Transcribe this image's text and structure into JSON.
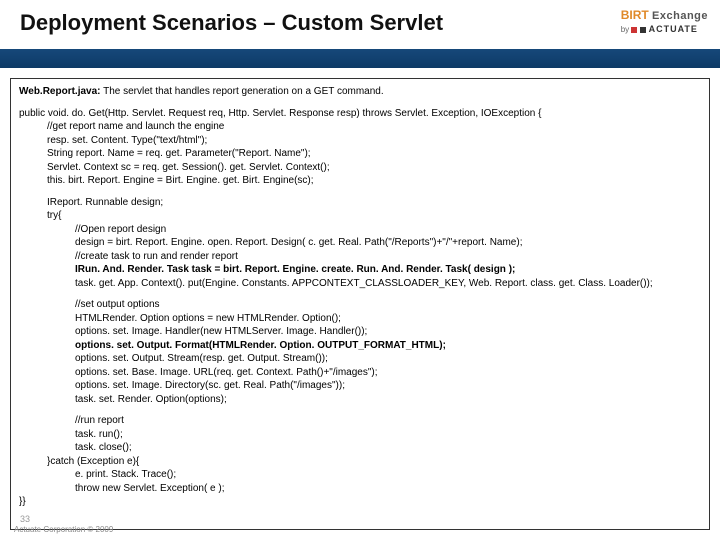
{
  "title": "Deployment Scenarios – Custom Servlet",
  "brand": {
    "birt": "BIRT",
    "exchange": "Exchange",
    "by": "by",
    "actuate": "ACTUATE"
  },
  "desc": {
    "filename": "Web.Report.java:",
    "text": " The servlet that handles report generation on a GET command."
  },
  "code": {
    "l0": "public void. do. Get(Http. Servlet. Request req, Http. Servlet. Response resp) throws Servlet. Exception, IOException {",
    "l1": "//get report name and launch the engine",
    "l2": "resp. set. Content. Type(\"text/html\");",
    "l3": "String report. Name = req. get. Parameter(\"Report. Name\");",
    "l4": "Servlet. Context sc = req. get. Session(). get. Servlet. Context();",
    "l5": "this. birt. Report. Engine = Birt. Engine. get. Birt. Engine(sc);",
    "l6": "IReport. Runnable design;",
    "l7": "try{",
    "l8": "//Open report design",
    "l9": "design = birt. Report. Engine. open. Report. Design( c. get. Real. Path(\"/Reports\")+\"/\"+report. Name);",
    "l10": "//create task to run and render report",
    "l11": "IRun. And. Render. Task task = birt. Report. Engine. create. Run. And. Render. Task( design );",
    "l12": "task. get. App. Context(). put(Engine. Constants. APPCONTEXT_CLASSLOADER_KEY, Web. Report. class. get. Class. Loader());",
    "l13": "//set output options",
    "l14": "HTMLRender. Option options = new HTMLRender. Option();",
    "l15": "options. set. Image. Handler(new HTMLServer. Image. Handler());",
    "l16": "options. set. Output. Format(HTMLRender. Option. OUTPUT_FORMAT_HTML);",
    "l17": "options. set. Output. Stream(resp. get. Output. Stream());",
    "l18": "options. set. Base. Image. URL(req. get. Context. Path()+\"/images\");",
    "l19": "options. set. Image. Directory(sc. get. Real. Path(\"/images\"));",
    "l20": "task. set. Render. Option(options);",
    "l21": "//run report",
    "l22": "task. run();",
    "l23": "task. close();",
    "l24": "}catch (Exception e){",
    "l25": "e. print. Stack. Trace();",
    "l26": "throw new Servlet. Exception( e );",
    "l27": "}}"
  },
  "footer": {
    "pagenum": "33",
    "copyright": "Actuate Corporation © 2009"
  }
}
